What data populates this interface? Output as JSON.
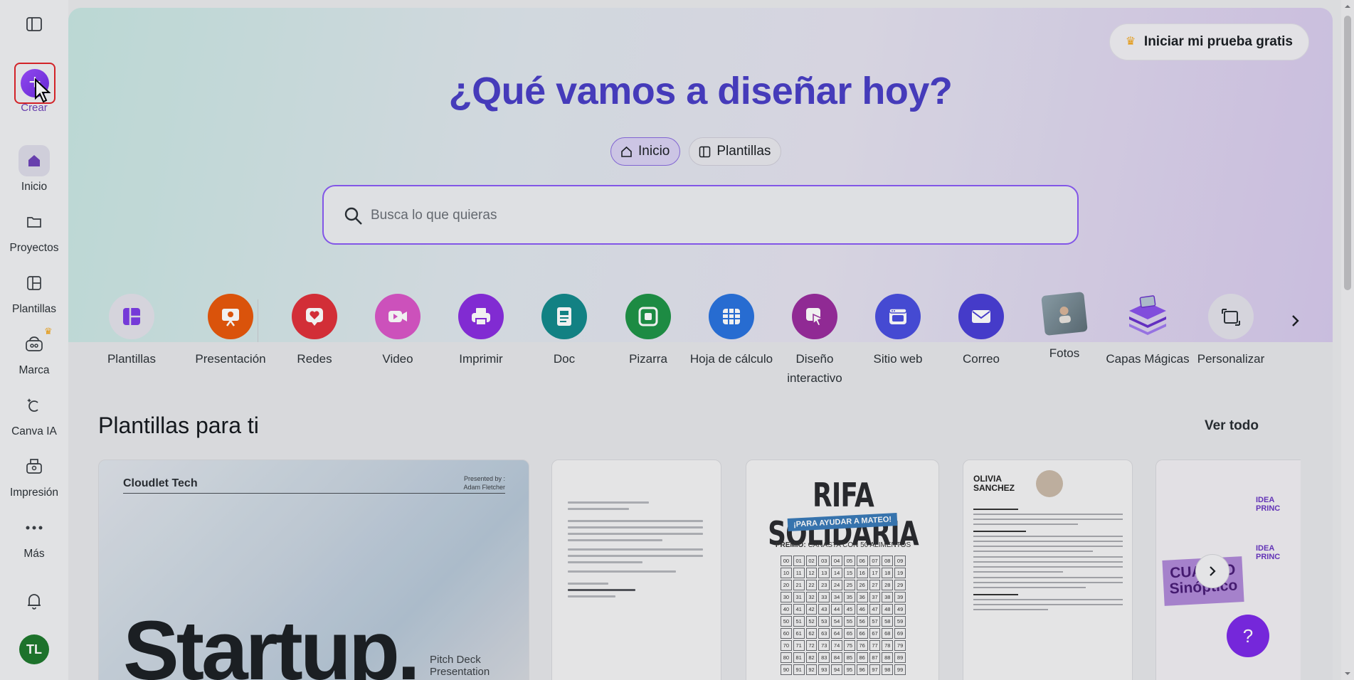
{
  "sidebar": {
    "create_label": "Crear",
    "items": [
      {
        "label": "Inicio",
        "icon": "home-icon",
        "active": true
      },
      {
        "label": "Proyectos",
        "icon": "folder-icon"
      },
      {
        "label": "Plantillas",
        "icon": "templates-icon"
      },
      {
        "label": "Marca",
        "icon": "brand-icon"
      },
      {
        "label": "Canva IA",
        "icon": "ai-icon"
      },
      {
        "label": "Impresión",
        "icon": "print-icon"
      },
      {
        "label": "Más",
        "icon": "more-icon"
      }
    ],
    "avatar_initials": "TL"
  },
  "header": {
    "trial_button": "Iniciar mi prueba gratis",
    "title": "¿Qué vamos a diseñar hoy?",
    "tabs": [
      {
        "label": "Inicio",
        "active": true
      },
      {
        "label": "Plantillas",
        "active": false
      }
    ]
  },
  "search": {
    "placeholder": "Busca lo que quieras"
  },
  "categories": [
    {
      "label": "Plantillas",
      "color": "#e3e2ea",
      "icon": "templates-icon"
    },
    {
      "label": "Presentación",
      "color": "#e8590c",
      "icon": "presentation-icon"
    },
    {
      "label": "Redes",
      "color": "#e0313b",
      "icon": "heart-icon"
    },
    {
      "label": "Video",
      "color": "#d957c7",
      "icon": "video-icon"
    },
    {
      "label": "Imprimir",
      "color": "#8a2ee0",
      "icon": "printer-icon"
    },
    {
      "label": "Doc",
      "color": "#148a8c",
      "icon": "doc-icon"
    },
    {
      "label": "Pizarra",
      "color": "#1f9448",
      "icon": "whiteboard-icon"
    },
    {
      "label": "Hoja de cálculo",
      "color": "#2a73df",
      "icon": "sheet-icon"
    },
    {
      "label": "Diseño interactivo",
      "color": "#9a2d9e",
      "icon": "interactive-icon"
    },
    {
      "label": "Sitio web",
      "color": "#4a4fe0",
      "icon": "website-icon"
    },
    {
      "label": "Correo",
      "color": "#4a3fd6",
      "icon": "mail-icon"
    },
    {
      "label": "Fotos",
      "color": "#7a8a94",
      "icon": "photos-icon"
    },
    {
      "label": "Capas Mágicas",
      "color": "#7b3fe0",
      "icon": "layers-icon"
    },
    {
      "label": "Personalizar",
      "color": "#e3e2ea",
      "icon": "custom-size-icon"
    }
  ],
  "section": {
    "title": "Plantillas para ti",
    "see_all": "Ver todo"
  },
  "templates": {
    "startup": {
      "logo": "Cloudlet Tech",
      "presented_by": "Presented by :",
      "presenter": "Adam Fletcher",
      "big": "Startup.",
      "sub1": "Pitch Deck",
      "sub2": "Presentation"
    },
    "rifa": {
      "title": "RIFA SOLIDARIA",
      "subtitle": "¡PARA AYUDAR A MATEO!",
      "prize_label": "PREMIO:",
      "prize": "CANASTA CON 50 ALIMENTOS"
    },
    "cv": {
      "first": "OLIVIA",
      "last": "SANCHEZ"
    },
    "cuadro": {
      "l1": "CUADRO",
      "l2": "Sinóptico",
      "idea": "IDEA PRINC"
    }
  },
  "help_label": "?"
}
